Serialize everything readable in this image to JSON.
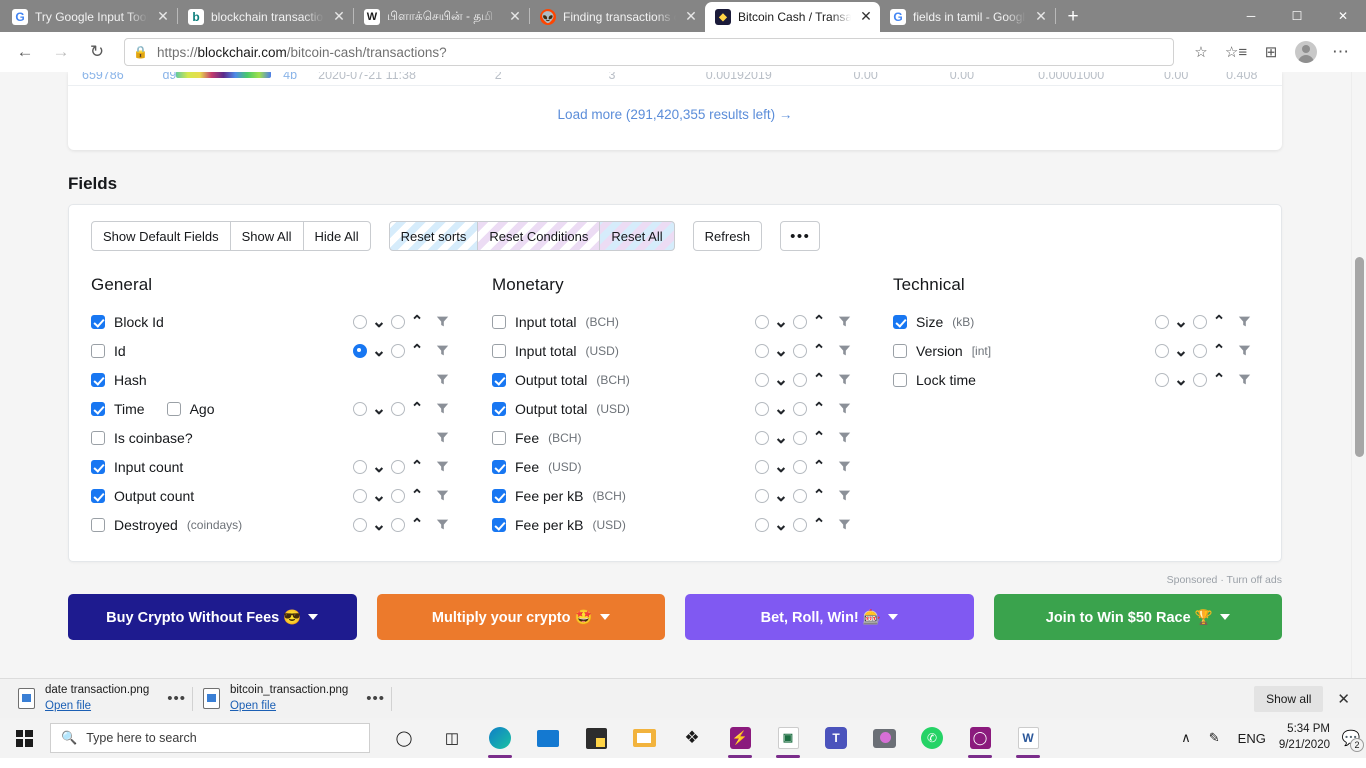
{
  "browser": {
    "tabs": [
      {
        "title": "Try Google Input Tools",
        "favicon": "google-icon",
        "active": false
      },
      {
        "title": "blockchain transaction",
        "favicon": "bing-icon",
        "active": false
      },
      {
        "title": "பிளாக்செயின் - தமி",
        "favicon": "wikipedia-icon",
        "active": false
      },
      {
        "title": "Finding transactions on",
        "favicon": "reddit-icon",
        "active": false
      },
      {
        "title": "Bitcoin Cash / Transacti",
        "favicon": "blockchair-icon",
        "active": true
      },
      {
        "title": "fields in tamil - Google",
        "favicon": "google-icon",
        "active": false
      }
    ],
    "newtab_label": "+",
    "window_controls": {
      "minimize": "─",
      "maximize": "☐",
      "close": "✕"
    },
    "toolbar": {
      "back": "←",
      "forward": "→",
      "reload": "↻",
      "url_scheme": "https://",
      "url_host": "blockchair.com",
      "url_path": "/bitcoin-cash/transactions?",
      "lock_icon": "lock-icon",
      "favorite_icon": "add-favorite-icon",
      "favorites_bar_icon": "favorites-list-icon",
      "collections_icon": "collections-icon",
      "profile_icon": "profile-avatar-icon",
      "settings_icon": "settings-more-icon"
    }
  },
  "page": {
    "cut_row": {
      "block_id": "659786",
      "hash_prefix": "d9",
      "hash_suffix": "4b",
      "time": "2020-07-21 11:38",
      "input_count": "2",
      "output_count": "3",
      "output_total_bch": "0.00192019",
      "output_total_usd": "0.00",
      "fee_usd": "0.00",
      "fee_per_kb_bch": "0.00001000",
      "fee_per_kb_usd": "0.00",
      "size": "0.408"
    },
    "load_more": "Load more (291,420,355 results left) →",
    "fields_heading": "Fields",
    "buttons": {
      "show_default_fields": "Show Default Fields",
      "show_all": "Show All",
      "hide_all": "Hide All",
      "reset_sorts": "Reset sorts",
      "reset_conditions": "Reset Conditions",
      "reset_all": "Reset All",
      "refresh": "Refresh",
      "more": "•••"
    },
    "columns": [
      {
        "title": "General",
        "rows": [
          {
            "label": "Block Id",
            "unit": "",
            "checked": true,
            "sort_desc": false,
            "sort_asc": false,
            "has_sort": true,
            "has_filter": true,
            "extra": null
          },
          {
            "label": "Id",
            "unit": "",
            "checked": false,
            "sort_desc": true,
            "sort_asc": false,
            "has_sort": true,
            "has_filter": true,
            "extra": null
          },
          {
            "label": "Hash",
            "unit": "",
            "checked": true,
            "sort_desc": false,
            "sort_asc": false,
            "has_sort": false,
            "has_filter": true,
            "extra": null
          },
          {
            "label": "Time",
            "unit": "",
            "checked": true,
            "sort_desc": false,
            "sort_asc": false,
            "has_sort": true,
            "has_filter": true,
            "extra": {
              "label": "Ago",
              "checked": false
            }
          },
          {
            "label": "Is coinbase?",
            "unit": "",
            "checked": false,
            "sort_desc": false,
            "sort_asc": false,
            "has_sort": false,
            "has_filter": true,
            "extra": null
          },
          {
            "label": "Input count",
            "unit": "",
            "checked": true,
            "sort_desc": false,
            "sort_asc": false,
            "has_sort": true,
            "has_filter": true,
            "extra": null
          },
          {
            "label": "Output count",
            "unit": "",
            "checked": true,
            "sort_desc": false,
            "sort_asc": false,
            "has_sort": true,
            "has_filter": true,
            "extra": null
          },
          {
            "label": "Destroyed",
            "unit": "(coindays)",
            "checked": false,
            "sort_desc": false,
            "sort_asc": false,
            "has_sort": true,
            "has_filter": true,
            "extra": null
          }
        ]
      },
      {
        "title": "Monetary",
        "rows": [
          {
            "label": "Input total",
            "unit": "(BCH)",
            "checked": false,
            "sort_desc": false,
            "sort_asc": false,
            "has_sort": true,
            "has_filter": true,
            "extra": null
          },
          {
            "label": "Input total",
            "unit": "(USD)",
            "checked": false,
            "sort_desc": false,
            "sort_asc": false,
            "has_sort": true,
            "has_filter": true,
            "extra": null
          },
          {
            "label": "Output total",
            "unit": "(BCH)",
            "checked": true,
            "sort_desc": false,
            "sort_asc": false,
            "has_sort": true,
            "has_filter": true,
            "extra": null
          },
          {
            "label": "Output total",
            "unit": "(USD)",
            "checked": true,
            "sort_desc": false,
            "sort_asc": false,
            "has_sort": true,
            "has_filter": true,
            "extra": null
          },
          {
            "label": "Fee",
            "unit": "(BCH)",
            "checked": false,
            "sort_desc": false,
            "sort_asc": false,
            "has_sort": true,
            "has_filter": true,
            "extra": null
          },
          {
            "label": "Fee",
            "unit": "(USD)",
            "checked": true,
            "sort_desc": false,
            "sort_asc": false,
            "has_sort": true,
            "has_filter": true,
            "extra": null
          },
          {
            "label": "Fee per kB",
            "unit": "(BCH)",
            "checked": true,
            "sort_desc": false,
            "sort_asc": false,
            "has_sort": true,
            "has_filter": true,
            "extra": null
          },
          {
            "label": "Fee per kB",
            "unit": "(USD)",
            "checked": true,
            "sort_desc": false,
            "sort_asc": false,
            "has_sort": true,
            "has_filter": true,
            "extra": null
          }
        ]
      },
      {
        "title": "Technical",
        "rows": [
          {
            "label": "Size",
            "unit": "(kB)",
            "checked": true,
            "sort_desc": false,
            "sort_asc": false,
            "has_sort": true,
            "has_filter": true,
            "extra": null
          },
          {
            "label": "Version",
            "unit": "[int]",
            "checked": false,
            "sort_desc": false,
            "sort_asc": false,
            "has_sort": true,
            "has_filter": true,
            "extra": null
          },
          {
            "label": "Lock time",
            "unit": "",
            "checked": false,
            "sort_desc": false,
            "sort_asc": false,
            "has_sort": true,
            "has_filter": true,
            "extra": null
          }
        ]
      }
    ],
    "sponsored_note": "Sponsored · Turn off ads",
    "ads": [
      {
        "label": "Buy Crypto Without Fees 😎",
        "color": "#1e1b8f"
      },
      {
        "label": "Multiply your crypto 🤩",
        "color": "#ec7a2c"
      },
      {
        "label": "Bet, Roll, Win! 🎰",
        "color": "#8059f2"
      },
      {
        "label": "Join to Win $50 Race 🏆",
        "color": "#3aa34d"
      }
    ]
  },
  "downloads": {
    "items": [
      {
        "name": "date transaction.png",
        "action": "Open file",
        "menu": "•••"
      },
      {
        "name": "bitcoin_transaction.png",
        "action": "Open file",
        "menu": "•••"
      }
    ],
    "show_all": "Show all",
    "close": "✕"
  },
  "taskbar": {
    "search_placeholder": "Type here to search",
    "icons": [
      {
        "name": "cortana-icon",
        "glyph": "○"
      },
      {
        "name": "task-view-icon",
        "glyph": "☰"
      },
      {
        "name": "edge-icon",
        "glyph": "e"
      },
      {
        "name": "mail-icon",
        "glyph": "✉"
      },
      {
        "name": "sticky-notes-icon",
        "glyph": "■"
      },
      {
        "name": "file-explorer-icon",
        "glyph": "🗀"
      },
      {
        "name": "dropbox-icon",
        "glyph": "❖"
      },
      {
        "name": "shazam-icon",
        "glyph": "S"
      },
      {
        "name": "excel-icon",
        "glyph": "X"
      },
      {
        "name": "teams-icon",
        "glyph": "T"
      },
      {
        "name": "camera-icon",
        "glyph": "◉"
      },
      {
        "name": "whatsapp-icon",
        "glyph": "✆"
      },
      {
        "name": "opera-icon",
        "glyph": "O"
      },
      {
        "name": "word-icon",
        "glyph": "W"
      }
    ],
    "tray": {
      "chevron": "∧",
      "pen_icon": "pen-icon",
      "language": "ENG",
      "time": "5:34 PM",
      "date": "9/21/2020",
      "notification_count": "2"
    }
  }
}
